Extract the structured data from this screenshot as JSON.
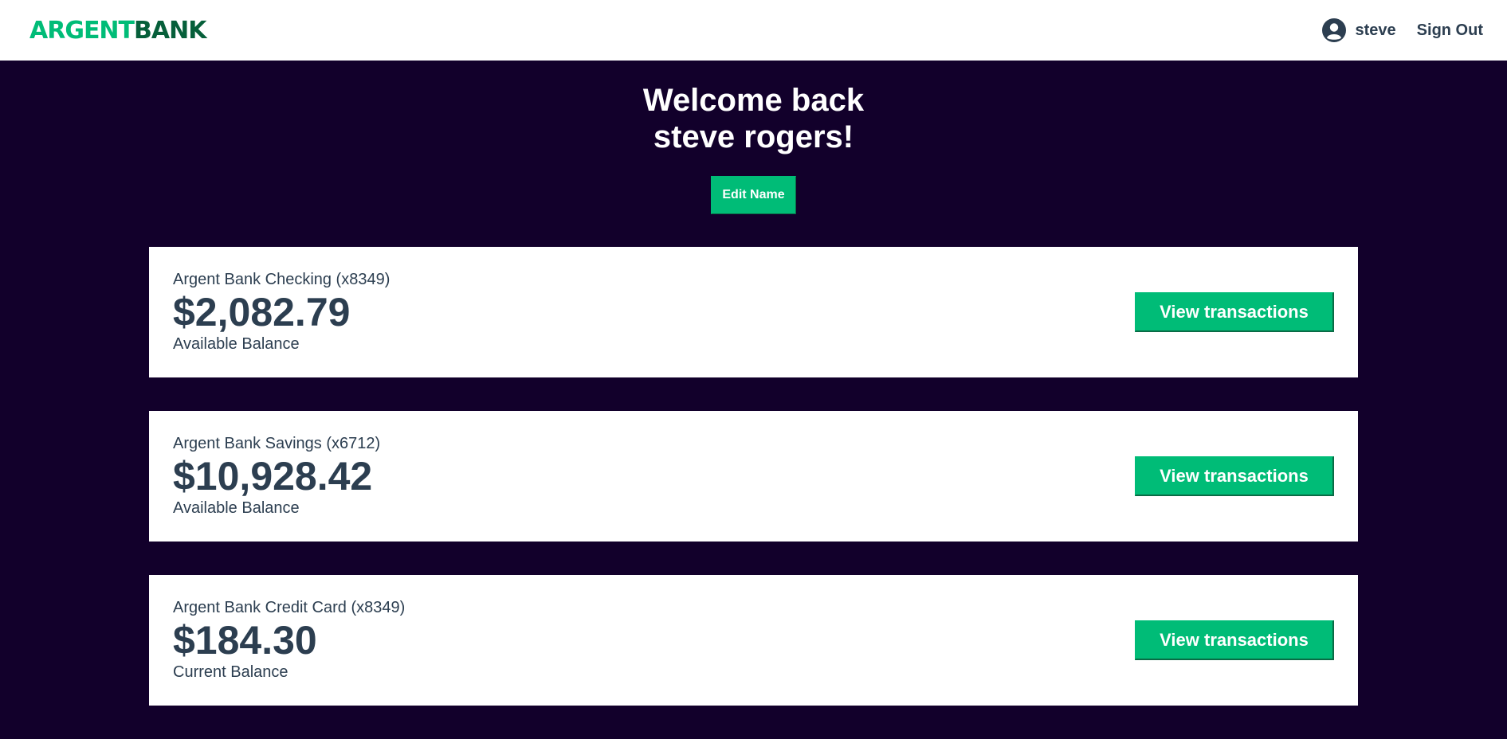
{
  "header": {
    "logo_part1": "ARGENT",
    "logo_part2": "BANK",
    "user_name": "steve",
    "user_icon": "user-circle-icon",
    "signout_label": "Sign Out"
  },
  "hero": {
    "line1": "Welcome back",
    "line2": "steve rogers!",
    "edit_label": "Edit Name"
  },
  "accounts": [
    {
      "title": "Argent Bank Checking (x8349)",
      "amount": "$2,082.79",
      "description": "Available Balance",
      "button": "View transactions"
    },
    {
      "title": "Argent Bank Savings (x6712)",
      "amount": "$10,928.42",
      "description": "Available Balance",
      "button": "View transactions"
    },
    {
      "title": "Argent Bank Credit Card (x8349)",
      "amount": "$184.30",
      "description": "Current Balance",
      "button": "View transactions"
    }
  ],
  "colors": {
    "accent": "#00bc77",
    "background": "#12002b",
    "text": "#2c3e50"
  }
}
